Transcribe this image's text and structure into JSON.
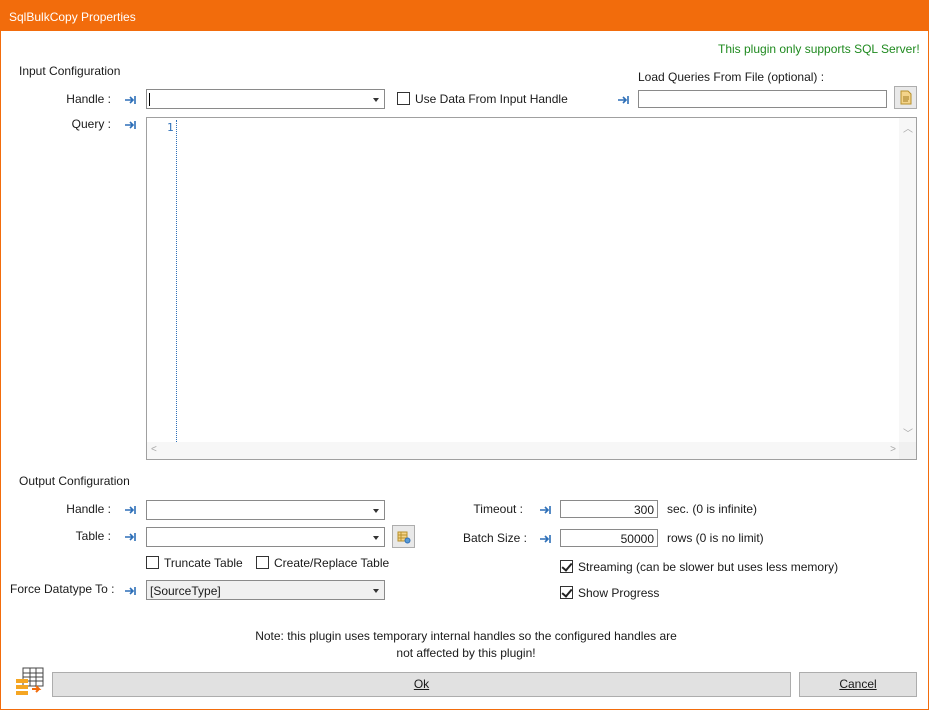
{
  "window": {
    "title": "SqlBulkCopy Properties"
  },
  "notice": "This plugin only supports SQL Server!",
  "input": {
    "section_label": "Input Configuration",
    "handle_label": "Handle :",
    "handle_value": "",
    "use_data_label": "Use Data From Input Handle",
    "use_data_checked": false,
    "load_queries_label": "Load Queries From File (optional) :",
    "load_queries_value": "",
    "query_label": "Query :",
    "query_line_number": "1"
  },
  "output": {
    "section_label": "Output Configuration",
    "handle_label": "Handle :",
    "handle_value": "",
    "table_label": "Table :",
    "table_value": "",
    "truncate_label": "Truncate Table",
    "truncate_checked": false,
    "create_replace_label": "Create/Replace Table",
    "create_replace_checked": false,
    "force_datatype_label": "Force Datatype To :",
    "force_datatype_value": "[SourceType]",
    "timeout_label": "Timeout :",
    "timeout_value": "300",
    "timeout_hint": "sec. (0 is infinite)",
    "batch_label": "Batch Size :",
    "batch_value": "50000",
    "batch_hint": "rows (0 is no limit)",
    "streaming_label": "Streaming (can be slower but uses less memory)",
    "streaming_checked": true,
    "progress_label": "Show Progress",
    "progress_checked": true
  },
  "footer": {
    "note_line1": "Note: this plugin uses temporary internal handles so the configured handles are",
    "note_line2": "not affected by this plugin!",
    "ok_label": "Ok",
    "cancel_label": "Cancel"
  },
  "icons": {
    "pin": "pin-arrow-icon",
    "folder": "open-file-icon",
    "table_lookup": "table-lookup-icon",
    "plugin": "plugin-table-icon"
  },
  "colors": {
    "accent": "#f26c0c",
    "notice": "#1f8a1f",
    "pin": "#2d6fb8"
  }
}
